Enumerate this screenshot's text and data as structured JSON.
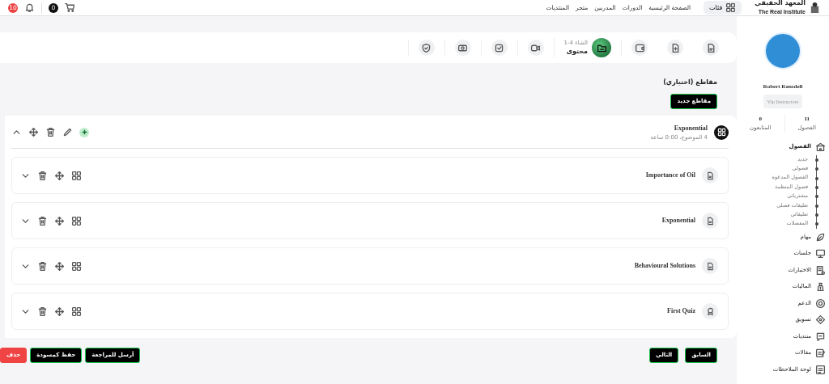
{
  "topbar": {
    "logo_title": "المعهد الحقيقي",
    "logo_subtitle": "The Real Institute",
    "categories_button": "فئات",
    "nav_links": [
      "الصفحة الرئيسية",
      "الدورات",
      "المدربين",
      "متجر",
      "المنتديات"
    ],
    "cart_count": "0",
    "notification_count": "10"
  },
  "steps": [
    {
      "selected": false
    },
    {
      "selected": false
    },
    {
      "selected": false
    },
    {
      "selected": true,
      "caption": "الشاء 4-1",
      "title": "محتوى"
    },
    {
      "selected": false
    },
    {
      "selected": false
    },
    {
      "selected": false
    },
    {
      "selected": false
    }
  ],
  "sections": {
    "title": "مقاطع (اختياري)",
    "new_button": "مقاطع جديد",
    "chapter": {
      "title": "Exponential",
      "meta": "4 الموضوع، 0:00 ساعة",
      "items": [
        {
          "kind": "lesson",
          "title": "Importance of Oil"
        },
        {
          "kind": "lesson",
          "title": "Exponential"
        },
        {
          "kind": "lesson",
          "title": "Behavioural Solutions"
        },
        {
          "kind": "quiz",
          "title": "First Quiz"
        }
      ]
    }
  },
  "footer": {
    "previous": "السابق",
    "next": "التالي",
    "submit": "أرسل للمراجعة",
    "save_draft": "حفظ كمسودة",
    "delete": "حذف"
  },
  "profile": {
    "name": "Robert Ransdell",
    "role": "Vip Instructors",
    "stats": [
      {
        "value": "11",
        "label": "الفصول"
      },
      {
        "value": "0",
        "label": "المتابعون"
      }
    ]
  },
  "sidebar": {
    "items": [
      {
        "label": "الفصول",
        "expanded": true,
        "children": [
          {
            "label": "جديد"
          },
          {
            "label": "فصولي"
          },
          {
            "label": "الفصول المدعوة"
          },
          {
            "label": "فصول المنظمة"
          },
          {
            "label": "مشترياتي"
          },
          {
            "label": "تعليقات فصلي"
          },
          {
            "label": "تعليقاتي"
          },
          {
            "label": "المفضلات"
          }
        ]
      },
      {
        "label": "مهام",
        "expanded": false
      },
      {
        "label": "جلسات",
        "expanded": false
      },
      {
        "label": "الاختبارات",
        "expanded": false
      },
      {
        "label": "الماليات",
        "expanded": false
      },
      {
        "label": "الدعم",
        "expanded": false
      },
      {
        "label": "تسويق",
        "expanded": false
      },
      {
        "label": "منتديات",
        "expanded": false
      },
      {
        "label": "مقالات",
        "expanded": false
      },
      {
        "label": "لوحة الملاحظات",
        "expanded": false
      }
    ]
  }
}
